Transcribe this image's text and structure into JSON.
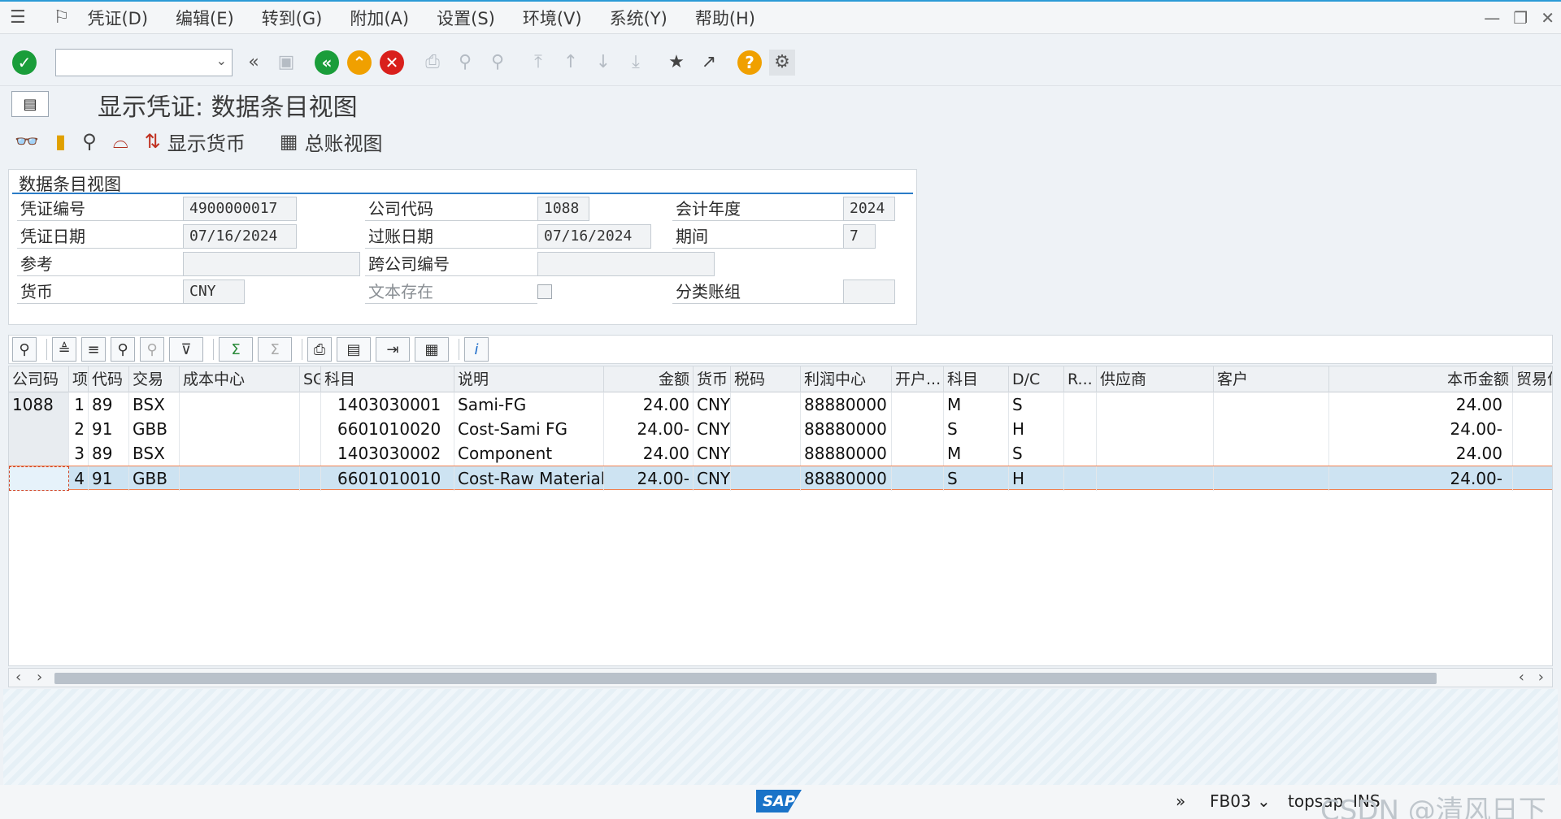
{
  "menu": {
    "items": [
      "凭证(D)",
      "编辑(E)",
      "转到(G)",
      "附加(A)",
      "设置(S)",
      "环境(V)",
      "系统(Y)",
      "帮助(H)"
    ]
  },
  "window_controls": [
    "minimize-icon",
    "restore-icon",
    "close-icon"
  ],
  "toolbar": {
    "command_field_value": "",
    "icons": [
      "enter-icon",
      "history-icon",
      "save-icon",
      "back-icon",
      "exit-icon",
      "cancel-icon",
      "print-icon",
      "find-icon",
      "find-next-icon",
      "first-page-icon",
      "prev-page-icon",
      "next-page-icon",
      "last-page-icon",
      "new-session-icon",
      "shortcut-icon",
      "help-icon",
      "settings-icon"
    ]
  },
  "title": "显示凭证: 数据条目视图",
  "app_toolbar": {
    "display_currency_label": "显示货币",
    "gl_view_label": "总账视图"
  },
  "header_panel": {
    "title": "数据条目视图",
    "doc_number_label": "凭证编号",
    "doc_number": "4900000017",
    "company_code_label": "公司代码",
    "company_code": "1088",
    "fiscal_year_label": "会计年度",
    "fiscal_year": "2024",
    "doc_date_label": "凭证日期",
    "doc_date": "07/16/2024",
    "posting_date_label": "过账日期",
    "posting_date": "07/16/2024",
    "period_label": "期间",
    "period": "7",
    "reference_label": "参考",
    "reference": "",
    "cross_company_label": "跨公司编号",
    "cross_company": "",
    "currency_label": "货币",
    "currency": "CNY",
    "text_exists_label": "文本存在",
    "ledger_group_label": "分类账组",
    "ledger_group": ""
  },
  "grid": {
    "columns": [
      "公司码",
      "项",
      "代码",
      "交易",
      "成本中心",
      "SG",
      "科目",
      "说明",
      "金额",
      "货币",
      "税码",
      "利润中心",
      "开户...",
      "科目",
      "D/C",
      "R...",
      "供应商",
      "客户",
      "本币金额",
      "贸易伙"
    ],
    "rows": [
      {
        "company": "1088",
        "item": "1",
        "pk": "89",
        "trans": "BSX",
        "account": "1403030001",
        "desc": "Sami-FG",
        "amount": "24.00",
        "curr": "CNY",
        "profit_center": "88880000",
        "acct_type": "M",
        "dc": "S",
        "local_amount": "24.00"
      },
      {
        "company": "",
        "item": "2",
        "pk": "91",
        "trans": "GBB",
        "account": "6601010020",
        "desc": "Cost-Sami FG",
        "amount": "24.00-",
        "curr": "CNY",
        "profit_center": "88880000",
        "acct_type": "S",
        "dc": "H",
        "local_amount": "24.00-"
      },
      {
        "company": "",
        "item": "3",
        "pk": "89",
        "trans": "BSX",
        "account": "1403030002",
        "desc": "Component",
        "amount": "24.00",
        "curr": "CNY",
        "profit_center": "88880000",
        "acct_type": "M",
        "dc": "S",
        "local_amount": "24.00"
      },
      {
        "company": "",
        "item": "4",
        "pk": "91",
        "trans": "GBB",
        "account": "6601010010",
        "desc": "Cost-Raw Material",
        "amount": "24.00-",
        "curr": "CNY",
        "profit_center": "88880000",
        "acct_type": "S",
        "dc": "H",
        "local_amount": "24.00-"
      }
    ],
    "selected_row": 3
  },
  "status_bar": {
    "logo": "SAP",
    "transaction": "FB03",
    "system": "topsap",
    "mode": "INS",
    "watermark": "CSDN @清风日下"
  }
}
